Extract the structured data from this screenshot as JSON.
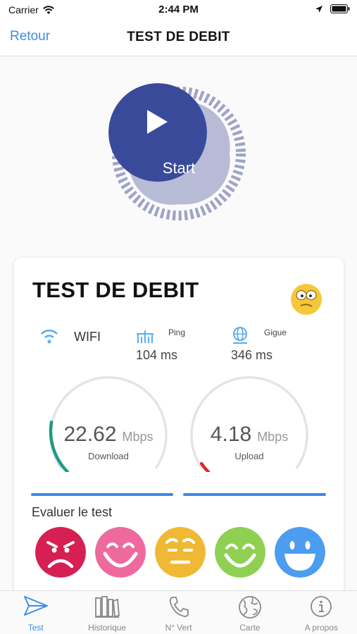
{
  "status_bar": {
    "carrier": "Carrier",
    "time": "2:44 PM"
  },
  "navbar": {
    "back_label": "Retour",
    "title": "TEST DE DEBIT"
  },
  "start": {
    "label": "Start"
  },
  "card": {
    "title": "TEST DE DEBIT",
    "wifi_label": "WIFI",
    "ping_label": "Ping",
    "ping_value": "104 ms",
    "gigue_label": "Gigue",
    "gigue_value": "346 ms",
    "download": {
      "value": "22.62",
      "unit": "Mbps",
      "caption": "Download",
      "fill_fraction": 0.2
    },
    "upload": {
      "value": "4.18",
      "unit": "Mbps",
      "caption": "Upload",
      "fill_fraction": 0.04
    },
    "rate_label": "Evaluer le test",
    "faces": [
      {
        "name": "angry",
        "color": "#d61f52"
      },
      {
        "name": "laughing",
        "color": "#ee6a9e"
      },
      {
        "name": "worried",
        "color": "#f0b934"
      },
      {
        "name": "smiling",
        "color": "#8fd053"
      },
      {
        "name": "happy",
        "color": "#4c9cf0"
      }
    ]
  },
  "tabs": [
    {
      "label": "Test",
      "icon": "send-icon",
      "active": true
    },
    {
      "label": "Historique",
      "icon": "books-icon",
      "active": false
    },
    {
      "label": "N° Vert",
      "icon": "phone-icon",
      "active": false
    },
    {
      "label": "Carte",
      "icon": "globe-icon",
      "active": false
    },
    {
      "label": "A propos",
      "icon": "info-icon",
      "active": false
    }
  ],
  "colors": {
    "accent": "#3a8ee6",
    "start_button": "#3a4a9a",
    "download_arc": "#1e9a87",
    "upload_arc": "#e0262b"
  }
}
